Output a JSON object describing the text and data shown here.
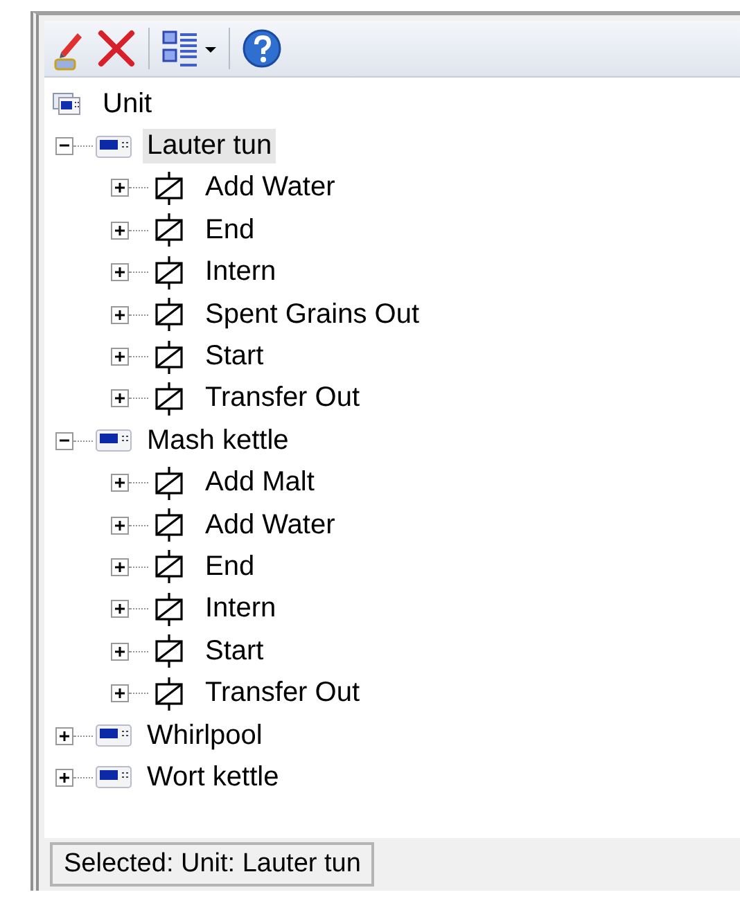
{
  "toolbar": {
    "buttons": [
      {
        "kind": "edit"
      },
      {
        "kind": "delete"
      },
      {
        "kind": "sep"
      },
      {
        "kind": "layout"
      },
      {
        "kind": "sep"
      },
      {
        "kind": "help"
      }
    ]
  },
  "tree": {
    "label": "Unit",
    "kind": "root",
    "children": [
      {
        "label": "Lauter tun",
        "kind": "unit",
        "expanded": true,
        "selected": true,
        "children": [
          {
            "label": "Add Water",
            "kind": "step",
            "expanded": false,
            "selected": false
          },
          {
            "label": "End",
            "kind": "step",
            "expanded": false,
            "selected": false
          },
          {
            "label": "Intern",
            "kind": "step",
            "expanded": false,
            "selected": false
          },
          {
            "label": "Spent Grains Out",
            "kind": "step",
            "expanded": false,
            "selected": false
          },
          {
            "label": "Start",
            "kind": "step",
            "expanded": false,
            "selected": false
          },
          {
            "label": "Transfer Out",
            "kind": "step",
            "expanded": false,
            "selected": false
          }
        ]
      },
      {
        "label": "Mash kettle",
        "kind": "unit",
        "expanded": true,
        "selected": false,
        "children": [
          {
            "label": "Add Malt",
            "kind": "step",
            "expanded": false,
            "selected": false
          },
          {
            "label": "Add Water",
            "kind": "step",
            "expanded": false,
            "selected": false
          },
          {
            "label": "End",
            "kind": "step",
            "expanded": false,
            "selected": false
          },
          {
            "label": "Intern",
            "kind": "step",
            "expanded": false,
            "selected": false
          },
          {
            "label": "Start",
            "kind": "step",
            "expanded": false,
            "selected": false
          },
          {
            "label": "Transfer Out",
            "kind": "step",
            "expanded": false,
            "selected": false
          }
        ]
      },
      {
        "label": "Whirlpool",
        "kind": "unit",
        "expanded": false,
        "selected": false
      },
      {
        "label": "Wort kettle",
        "kind": "unit",
        "expanded": false,
        "selected": false
      }
    ]
  },
  "status_bar": {
    "text": "Selected: Unit: Lauter tun"
  }
}
